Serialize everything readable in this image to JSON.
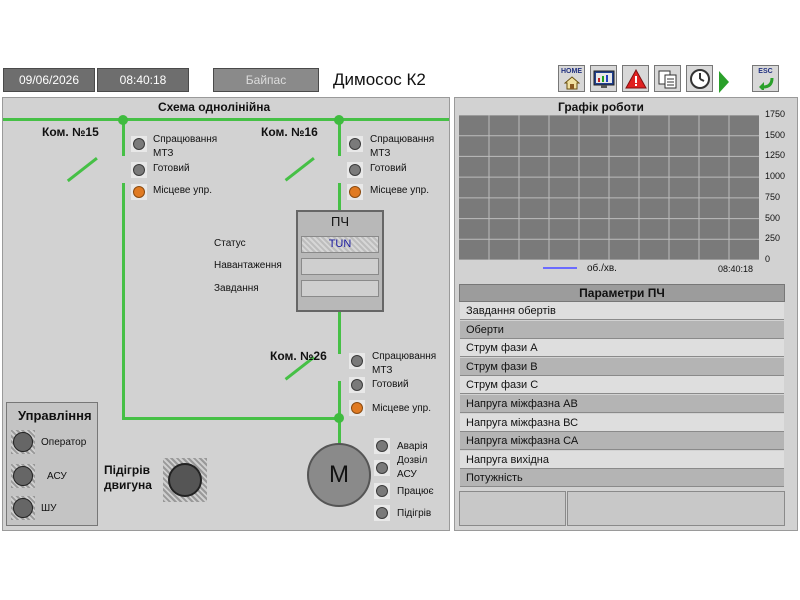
{
  "header": {
    "date": "09/06/2026",
    "time": "08:40:18",
    "bypass": "Байпас",
    "title": "Димосос К2",
    "home_label": "HOME",
    "esc_label": "ESC"
  },
  "scheme": {
    "title": "Схема однолінійна",
    "com15": {
      "label": "Ком. №15",
      "trip": "Спрацювання",
      "trip2": "МТЗ",
      "ready": "Готовий",
      "local": "Місцеве упр."
    },
    "com16": {
      "label": "Ком. №16",
      "trip": "Спрацювання",
      "trip2": "МТЗ",
      "ready": "Готовий",
      "local": "Місцеве упр."
    },
    "com26": {
      "label": "Ком. №26",
      "trip": "Спрацювання",
      "trip2": "МТЗ",
      "ready": "Готовий",
      "local": "Місцеве упр."
    },
    "vfd": {
      "title": "ПЧ",
      "status_label": "Статус",
      "status_value": "TUN",
      "load_label": "Навантаження",
      "task_label": "Завдання"
    },
    "control": {
      "title": "Управління",
      "operator": "Оператор",
      "asu": "АСУ",
      "shu": "ШУ"
    },
    "heating": {
      "line1": "Підігрів",
      "line2": "двигуна"
    },
    "motor": {
      "symbol": "M",
      "alarm": "Аварія",
      "permit1": "Дозвіл",
      "permit2": "АСУ",
      "running": "Працює",
      "heating": "Підігрів"
    }
  },
  "chart": {
    "title": "Графік роботи",
    "legend": "об./хв.",
    "time_label": "08:40:18",
    "yticks": [
      "1750",
      "1500",
      "1250",
      "1000",
      "750",
      "500",
      "250",
      "0"
    ]
  },
  "chart_data": {
    "type": "line",
    "title": "Графік роботи",
    "ylim": [
      0,
      1750
    ],
    "yticks": [
      1750,
      1500,
      1250,
      1000,
      750,
      500,
      250,
      0
    ],
    "series": [
      {
        "name": "об./хв.",
        "values": []
      }
    ],
    "x": [
      "08:40:18"
    ],
    "grid": true
  },
  "params": {
    "title": "Параметри ПЧ",
    "rows": [
      "Завдання обертів",
      "Оберти",
      "Струм фази А",
      "Струм фази В",
      "Струм фази С",
      "Напруга міжфазна АВ",
      "Напруга міжфазна ВС",
      "Напруга міжфазна СА",
      "Напруга вихідна",
      "Потужність"
    ]
  },
  "colors": {
    "line": "#46c046",
    "lamp_on": "#e07a22",
    "lamp_off": "#7a7a7a",
    "legend_line": "#6b6bff"
  }
}
